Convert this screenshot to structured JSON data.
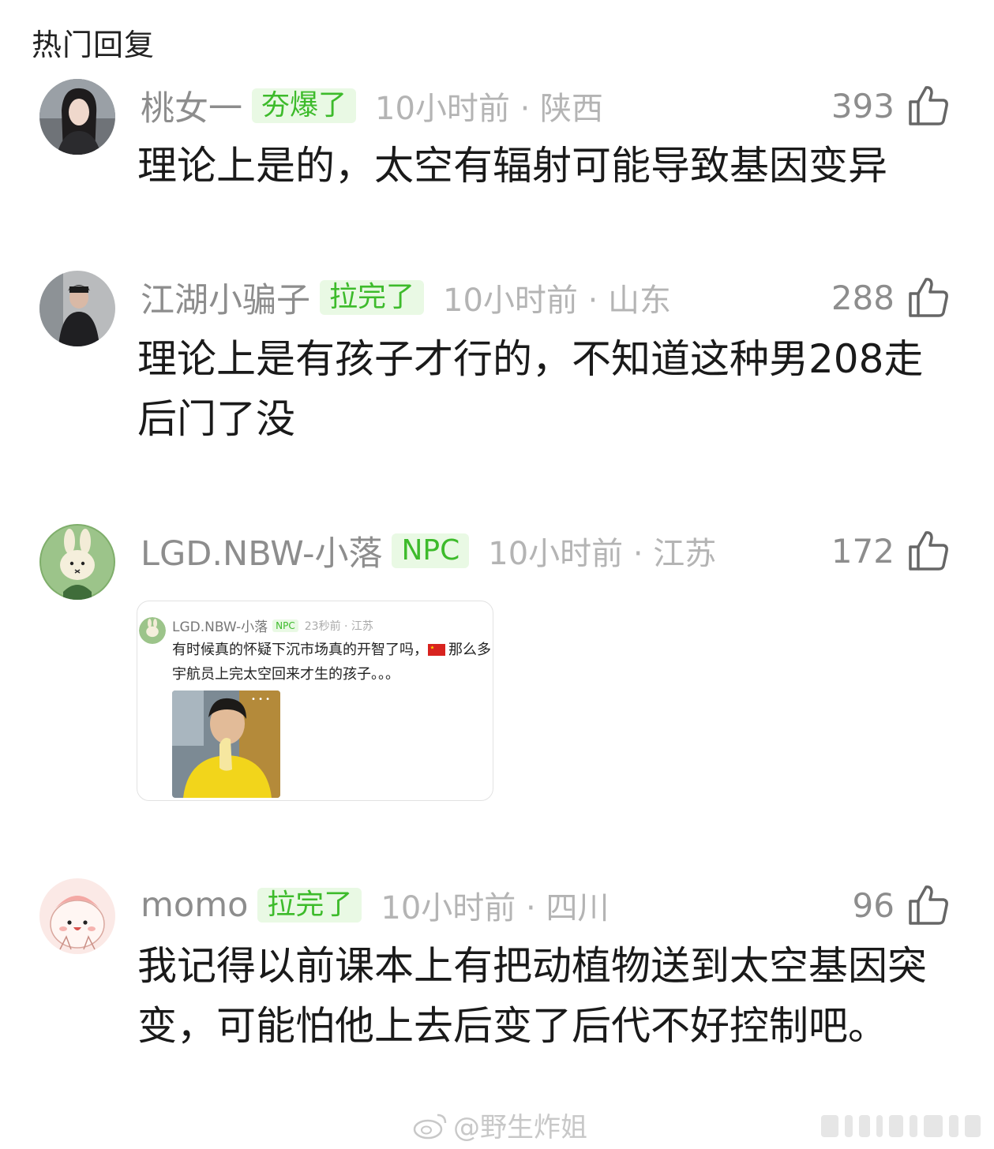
{
  "section_title": "热门回复",
  "comments": [
    {
      "username": "桃女一",
      "badge": "夯爆了",
      "meta": "10小时前 · 陕西",
      "likes": "393",
      "text": "理论上是的，太空有辐射可能导致基因变异",
      "avatar_icon": "user-avatar-photo"
    },
    {
      "username": "江湖小骗子",
      "badge": "拉完了",
      "meta": "10小时前 · 山东",
      "likes": "288",
      "text": "理论上是有孩子才行的，不知道这种男208走后门了没",
      "avatar_icon": "user-avatar-photo"
    },
    {
      "username": "LGD.NBW-小落",
      "badge": "NPC",
      "meta": "10小时前 · 江苏",
      "likes": "172",
      "text": "",
      "avatar_icon": "bunny-avatar",
      "embed": {
        "username": "LGD.NBW-小落",
        "badge": "NPC",
        "meta": "23秒前 · 江苏",
        "text_before_flag": "有时候真的怀疑下沉市场真的开智了吗，",
        "text_after_flag": "那么多宇航员上完太空回来才生的孩子。。。"
      }
    },
    {
      "username": "momo",
      "badge": "拉完了",
      "meta": "10小时前 · 四川",
      "likes": "96",
      "text": "我记得以前课本上有把动植物送到太空基因突变，可能怕他上去后变了后代不好控制吧。",
      "avatar_icon": "cartoon-face-avatar"
    }
  ],
  "watermark": "@野生炸姐",
  "colors": {
    "badge_text": "#3dbb2b",
    "badge_bg": "#e9f9e4",
    "meta": "#b4b4b4",
    "username": "#8d8d8d"
  }
}
